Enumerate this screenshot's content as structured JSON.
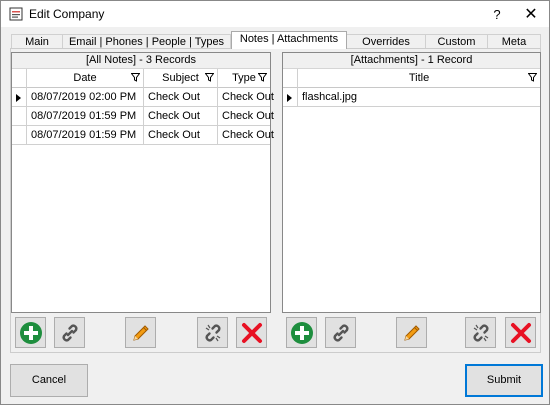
{
  "window": {
    "title": "Edit Company",
    "help_label": "?",
    "close_label": "✕"
  },
  "tabs": [
    {
      "label": "Main"
    },
    {
      "label": "Email | Phones | People | Types"
    },
    {
      "label": "Notes | Attachments"
    },
    {
      "label": "Overrides"
    },
    {
      "label": "Custom"
    },
    {
      "label": "Meta"
    }
  ],
  "notes": {
    "caption": "[All Notes] - 3 Records",
    "columns": [
      "Date",
      "Subject",
      "Type"
    ],
    "rows": [
      [
        "08/07/2019 02:00 PM",
        "Check Out",
        "Check Out"
      ],
      [
        "08/07/2019 01:59 PM",
        "Check Out",
        "Check Out"
      ],
      [
        "08/07/2019 01:59 PM",
        "Check Out",
        "Check Out"
      ]
    ]
  },
  "attachments": {
    "caption": "[Attachments] - 1 Record",
    "columns": [
      "Title"
    ],
    "rows": [
      [
        "flashcal.jpg"
      ]
    ]
  },
  "footer": {
    "cancel_label": "Cancel",
    "submit_label": "Submit"
  },
  "icons": {
    "add": "plus-circle-icon",
    "link": "link-icon",
    "edit": "pencil-icon",
    "unlink": "unlink-icon",
    "delete": "red-x-icon",
    "filter": "filter-funnel-icon",
    "row_selector": "row-pointer-icon",
    "app": "app-icon"
  },
  "colors": {
    "add_green": "#1e8e3e",
    "delete_red": "#e81123",
    "pencil_orange": "#f39c12",
    "primary_border": "#0078d7"
  }
}
